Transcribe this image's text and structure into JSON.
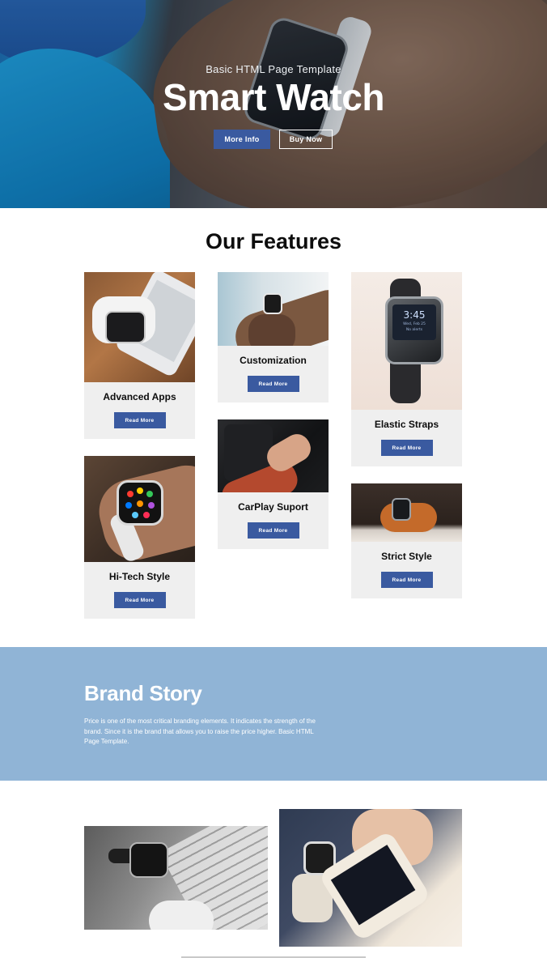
{
  "hero": {
    "kicker": "Basic HTML Page Template",
    "title": "Smart Watch",
    "buttons": {
      "more_info": "More Info",
      "buy_now": "Buy Now"
    }
  },
  "features": {
    "title": "Our Features",
    "cards": [
      {
        "label": "Advanced Apps",
        "button": "Read More"
      },
      {
        "label": "Customization",
        "button": "Read More"
      },
      {
        "label": "Elastic Straps",
        "button": "Read More"
      },
      {
        "label": "Hi-Tech Style",
        "button": "Read More"
      },
      {
        "label": "CarPlay Suport",
        "button": "Read More"
      },
      {
        "label": "Strict Style",
        "button": "Read More"
      }
    ]
  },
  "brand": {
    "title": "Brand Story",
    "text": "Price is one of the most critical branding elements. It indicates the strength of the brand. Since it is the brand that allows you to raise the price higher. Basic HTML Page Template."
  },
  "watch_screen": {
    "time": "3:45",
    "date": "Wed, Feb 25",
    "status": "No alerts"
  },
  "colors": {
    "accent": "#3a5aa0",
    "brand_bg": "#90b4d6",
    "card_bg": "#efefef"
  }
}
